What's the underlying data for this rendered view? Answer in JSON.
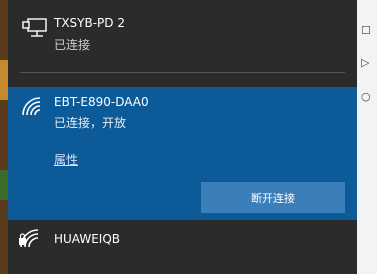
{
  "networks": [
    {
      "name": "TXSYB-PD 2",
      "status": "已连接",
      "type": "ethernet-icon"
    },
    {
      "name": "EBT-E890-DAA0",
      "status": "已连接，开放",
      "properties_link": "属性",
      "disconnect_button": "断开连接",
      "type": "wifi-icon"
    },
    {
      "name": "HUAWEIQB",
      "type": "wifi-secured-icon"
    }
  ],
  "colors": {
    "panel_bg": "#2b2b2b",
    "selected_bg": "#0d5a98",
    "button_bg": "#3b7fba"
  }
}
